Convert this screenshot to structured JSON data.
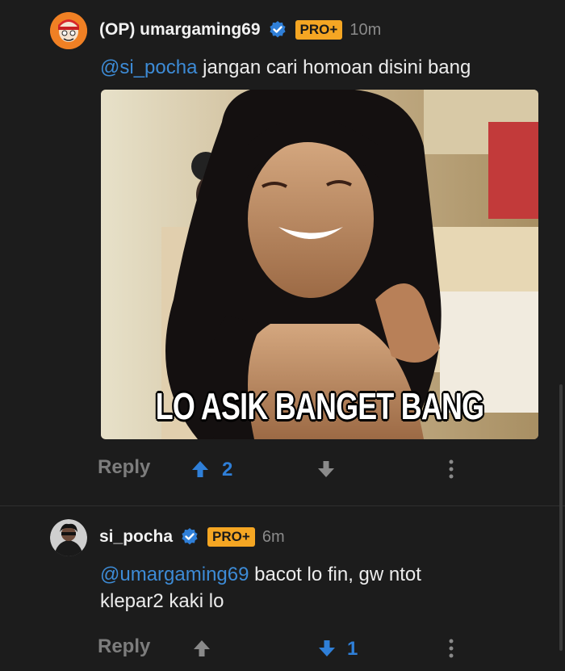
{
  "comments": [
    {
      "username": "(OP) umargaming69",
      "badge": "PRO+",
      "time": "10m",
      "mention": "@si_pocha",
      "text": " jangan cari homoan disini bang",
      "media_caption": "LO ASIK BANGET BANG",
      "reply_label": "Reply",
      "upvotes": "2",
      "vote_state": "upvoted"
    },
    {
      "username": "si_pocha",
      "badge": "PRO+",
      "time": "6m",
      "mention": "@umargaming69",
      "text": " bacot lo fin, gw ntot klepar2 kaki lo",
      "reply_label": "Reply",
      "downvotes": "1",
      "vote_state": "downvoted"
    }
  ],
  "colors": {
    "background": "#1c1c1c",
    "mention": "#3d8bd6",
    "vote_active": "#2f7fd8",
    "pro_badge": "#f5a623",
    "verified": "#2f7fd8"
  },
  "icons": [
    "avatar-op",
    "verified-icon",
    "upvote-arrow-icon",
    "downvote-arrow-icon",
    "more-options-icon",
    "avatar-si-pocha"
  ]
}
